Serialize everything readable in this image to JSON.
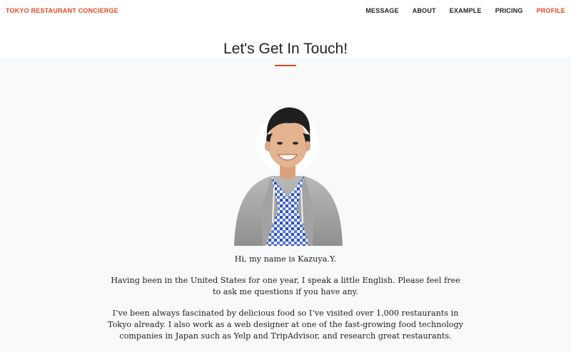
{
  "header": {
    "brand": "TOKYO RESTAURANT CONCIERGE",
    "nav": [
      {
        "label": "MESSAGE"
      },
      {
        "label": "ABOUT"
      },
      {
        "label": "EXAMPLE"
      },
      {
        "label": "PRICING"
      },
      {
        "label": "PROFILE",
        "active": true
      }
    ]
  },
  "section": {
    "title": "Let's Get In Touch!"
  },
  "profile": {
    "photo_alt": "Kazuya.Y. portrait",
    "paragraphs": [
      "Hi, my name is Kazuya.Y.",
      "Having been in the United States for one year, I speak a little English. Please feel free to ask me questions if you have any.",
      "I’ve been always fascinated by delicious food so I’ve visited over 1,000 restaurants in Tokyo already. I also work as a web designer at one of the fast-growing food technology companies in Japan such as Yelp and TripAdvisor, and research great restaurants."
    ]
  },
  "colors": {
    "accent": "#e8481f",
    "background": "#f7f9fa",
    "header_bg": "#ffffff"
  }
}
